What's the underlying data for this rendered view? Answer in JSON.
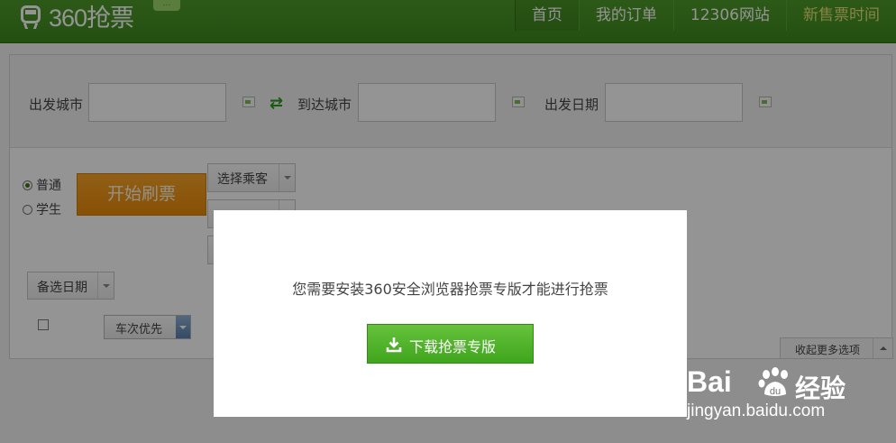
{
  "header": {
    "logo_text": "360抢票",
    "logo_badge": "…",
    "nav": [
      "首页",
      "我的订单",
      "12306网站",
      "新售票时间"
    ]
  },
  "search": {
    "from_label": "出发城市",
    "from_value": "",
    "to_label": "到达城市",
    "to_value": "",
    "date_label": "出发日期",
    "date_value": ""
  },
  "options": {
    "ticket_types": [
      {
        "label": "普通",
        "selected": true
      },
      {
        "label": "学生",
        "selected": false
      }
    ],
    "start_button": "开始刷票",
    "choose_passenger": "选择乘客",
    "hidden_dropdown": "…",
    "backup_date": "备选日期",
    "priority_select": "车次优先",
    "collapse": "收起更多选项"
  },
  "modal": {
    "message": "您需要安装360安全浏览器抢票专版才能进行抢票",
    "download_button": "下载抢票专版"
  },
  "watermark": {
    "brand": "Bai",
    "brand_cn": "经验",
    "url": "jingyan.baidu.com"
  },
  "colors": {
    "header_green": "#3d8a1e",
    "start_orange": "#f29a1a",
    "download_green": "#4fb02a"
  }
}
